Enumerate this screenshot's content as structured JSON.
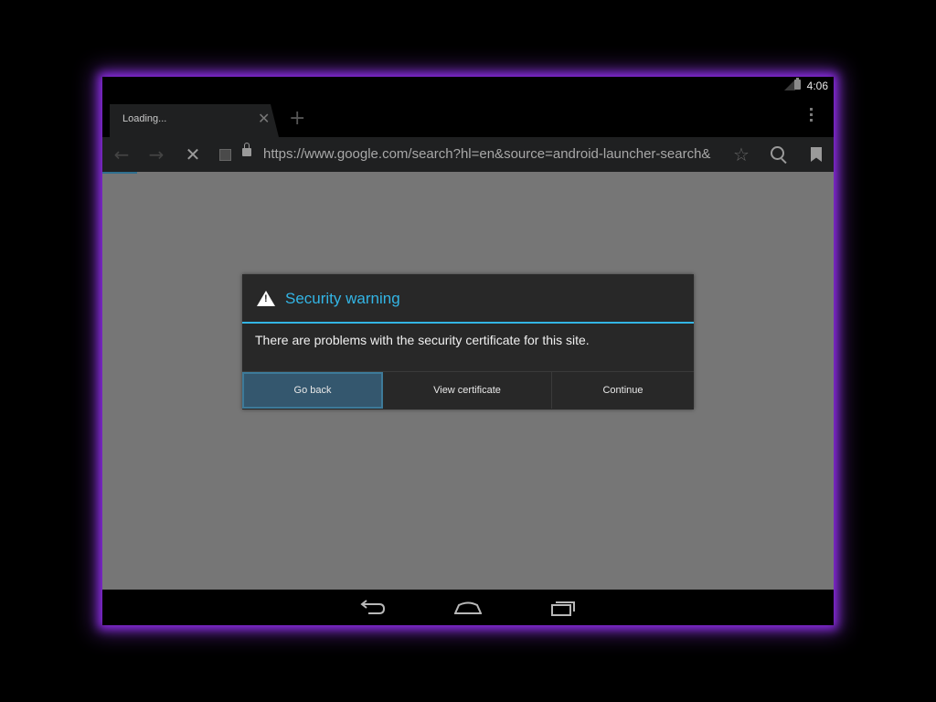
{
  "status_bar": {
    "time": "4:06",
    "icons": [
      "signal-icon",
      "battery-icon"
    ]
  },
  "tabs": [
    {
      "title": "Loading...",
      "active": true
    }
  ],
  "tab_strip": {
    "close_icon": "close-icon",
    "new_tab_icon": "plus-icon",
    "overflow_icon": "vertical-dots-icon"
  },
  "toolbar": {
    "url": "https://www.google.com/search?hl=en&source=android-launcher-search&",
    "icons": [
      "back-arrow-icon",
      "forward-arrow-icon",
      "stop-icon",
      "favicon",
      "lock-icon",
      "star-icon",
      "search-icon",
      "bookmark-icon"
    ]
  },
  "dialog": {
    "title": "Security warning",
    "message": "There are problems with the security certificate for this site.",
    "buttons": {
      "go_back": "Go back",
      "view_certificate": "View certificate",
      "continue": "Continue"
    },
    "accent_color": "#33b5e5"
  },
  "nav_bar": {
    "icons": [
      "nav-back-icon",
      "nav-home-icon",
      "nav-recents-icon"
    ]
  },
  "colors": {
    "device_glow": "#8a2be2",
    "content_background": "#767676",
    "dialog_background": "#282828",
    "selected_button": "#34576e"
  }
}
